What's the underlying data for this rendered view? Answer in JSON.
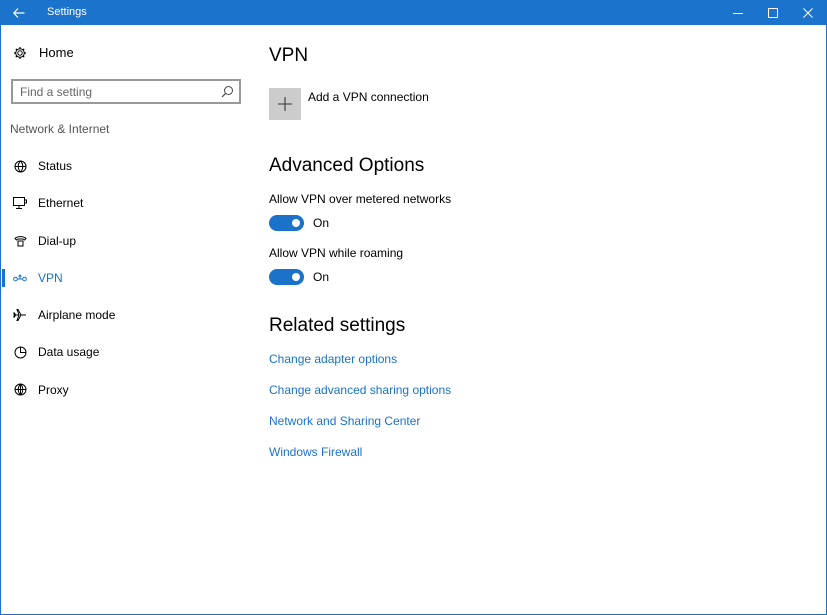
{
  "window": {
    "title": "Settings"
  },
  "sidebar": {
    "home_label": "Home",
    "search_placeholder": "Find a setting",
    "section_label": "Network & Internet",
    "items": [
      {
        "label": "Status",
        "icon": "globe-status-icon"
      },
      {
        "label": "Ethernet",
        "icon": "ethernet-icon"
      },
      {
        "label": "Dial-up",
        "icon": "dial-up-icon"
      },
      {
        "label": "VPN",
        "icon": "vpn-icon",
        "active": true
      },
      {
        "label": "Airplane mode",
        "icon": "airplane-icon"
      },
      {
        "label": "Data usage",
        "icon": "data-usage-icon"
      },
      {
        "label": "Proxy",
        "icon": "globe-icon"
      }
    ]
  },
  "main": {
    "title": "VPN",
    "add_vpn_label": "Add a VPN connection",
    "advanced": {
      "heading": "Advanced Options",
      "settings": [
        {
          "label": "Allow VPN over metered networks",
          "state": "On"
        },
        {
          "label": "Allow VPN while roaming",
          "state": "On"
        }
      ]
    },
    "related": {
      "heading": "Related settings",
      "links": [
        "Change adapter options",
        "Change advanced sharing options",
        "Network and Sharing Center",
        "Windows Firewall"
      ]
    }
  },
  "colors": {
    "accent": "#1a73c8",
    "titlebar": "#1c73cc",
    "tile": "#cccccc"
  }
}
